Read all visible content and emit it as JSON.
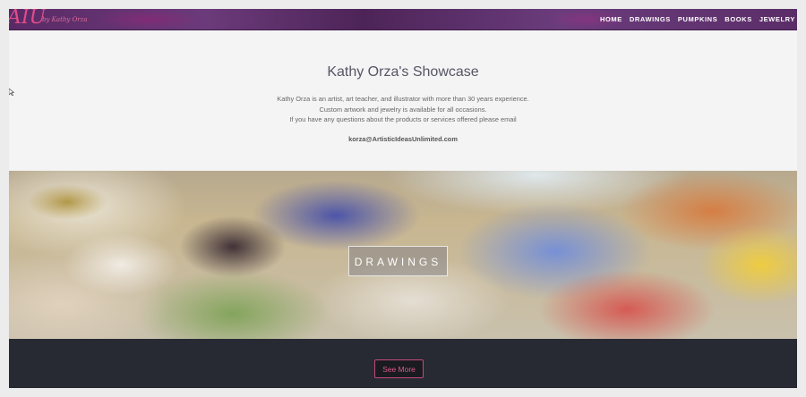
{
  "header": {
    "logo": "AIU",
    "logo_sub": "by Kathy Orza",
    "nav": [
      "HOME",
      "DRAWINGS",
      "PUMPKINS",
      "BOOKS",
      "JEWELRY"
    ]
  },
  "intro": {
    "title": "Kathy Orza's Showcase",
    "lines": [
      "Kathy Orza is an artist, art teacher, and illustrator with more than 30 years experience.",
      "Custom artwork and jewelry is available for all occasions.",
      "If you have any questions about the products or services offered please email"
    ],
    "email": "korza@ArtisticIdeasUnlimited.com"
  },
  "banner": {
    "label": "DRAWINGS"
  },
  "footer": {
    "button": "See More"
  },
  "colors": {
    "accent": "#d85a8e",
    "header_bg": "#5a2a66",
    "footer_bg": "#272a33"
  }
}
